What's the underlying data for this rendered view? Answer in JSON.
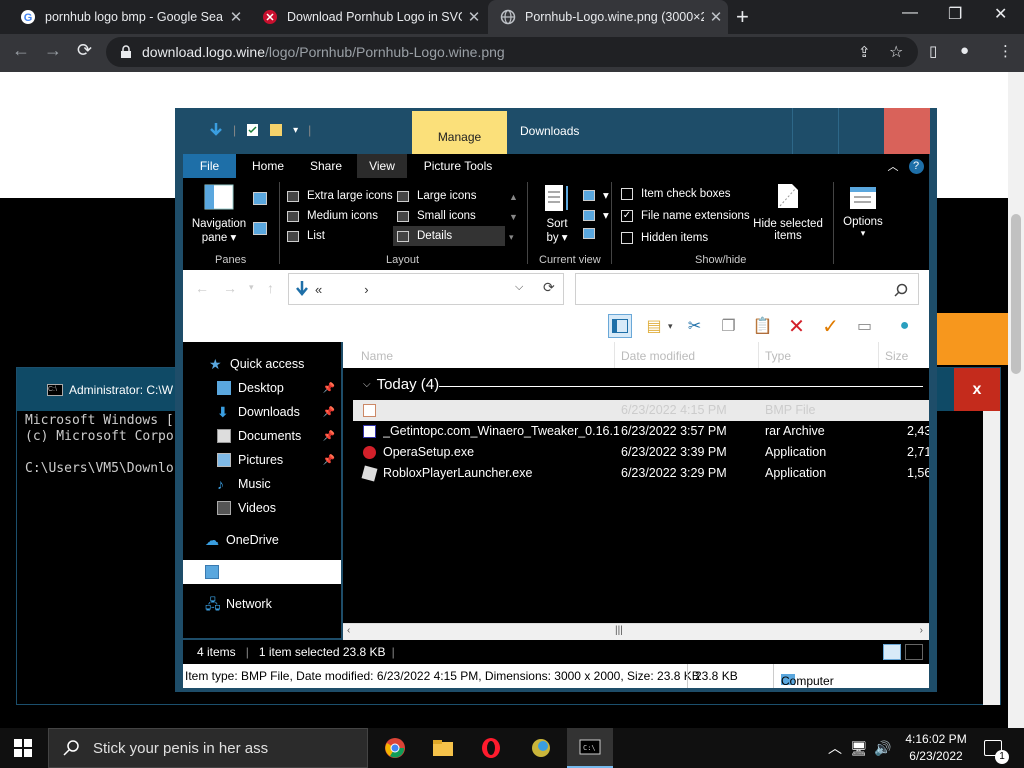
{
  "chrome": {
    "tabs": [
      {
        "title": "pornhub logo bmp - Google Sea",
        "icon": "google-icon"
      },
      {
        "title": "Download Pornhub Logo in SVG",
        "icon": "logowine-icon"
      },
      {
        "title": "Pornhub-Logo.wine.png (3000×2",
        "icon": "globe-icon"
      }
    ],
    "url_host": "download.logo.wine",
    "url_path": "/logo/Pornhub/Pornhub-Logo.wine.png"
  },
  "cmd": {
    "title": "Administrator: C:\\W",
    "lines": [
      "Microsoft Windows [",
      "(c) Microsoft Corpo",
      "",
      "C:\\Users\\VM5\\Downlo"
    ],
    "close": "x"
  },
  "explorer": {
    "manage_tab": "Manage",
    "window_title": "Downloads",
    "ribbon_tabs": [
      "File",
      "Home",
      "Share",
      "View",
      "Picture Tools"
    ],
    "panes": {
      "navigation_pane_l1": "Navigation",
      "navigation_pane_l2": "pane ▾",
      "label": "Panes"
    },
    "layout": {
      "label": "Layout",
      "items": [
        "Extra large icons",
        "Large icons",
        "Medium icons",
        "Small icons",
        "List",
        "Details"
      ]
    },
    "current_view": {
      "label": "Current view",
      "sort_l1": "Sort",
      "sort_l2": "by ▾"
    },
    "show_hide": {
      "label": "Show/hide",
      "item_check_boxes": "Item check boxes",
      "file_name_extensions": "File name extensions",
      "hidden_items": "Hidden items",
      "hide_selected_l1": "Hide selected",
      "hide_selected_l2": "items",
      "options": "Options"
    },
    "address": {
      "prefix": "«",
      "chevron": "›"
    },
    "nav": [
      {
        "label": "Quick access",
        "icon": "star-icon"
      },
      {
        "label": "Desktop",
        "icon": "desktop-icon",
        "pin": true
      },
      {
        "label": "Downloads",
        "icon": "download-icon",
        "pin": true
      },
      {
        "label": "Documents",
        "icon": "documents-icon",
        "pin": true
      },
      {
        "label": "Pictures",
        "icon": "pictures-icon",
        "pin": true
      },
      {
        "label": "Music",
        "icon": "music-icon"
      },
      {
        "label": "Videos",
        "icon": "videos-icon"
      },
      {
        "label": "OneDrive",
        "icon": "cloud-icon"
      },
      {
        "label": "",
        "icon": "computer-icon"
      },
      {
        "label": "Network",
        "icon": "network-icon"
      }
    ],
    "columns": [
      "Name",
      "Date modified",
      "Type",
      "Size"
    ],
    "group": "Today (4)",
    "files": [
      {
        "name": "",
        "date": "6/23/2022 4:15 PM",
        "type": "BMP File",
        "size": ""
      },
      {
        "name": "_Getintopc.com_Winaero_Tweaker_0.16.1...",
        "date": "6/23/2022 3:57 PM",
        "type": "rar Archive",
        "size": "2,43"
      },
      {
        "name": "OperaSetup.exe",
        "date": "6/23/2022 3:39 PM",
        "type": "Application",
        "size": "2,71"
      },
      {
        "name": "RobloxPlayerLauncher.exe",
        "date": "6/23/2022 3:29 PM",
        "type": "Application",
        "size": "1,56"
      }
    ],
    "status": {
      "items": "4 items",
      "selected": "1 item selected  23.8 KB",
      "sep": "|"
    },
    "details": {
      "info": "Item type: BMP File, Date modified: 6/23/2022 4:15 PM, Dimensions: 3000 x 2000, Size: 23.8 KB",
      "size": "23.8 KB",
      "location": "Computer"
    }
  },
  "taskbar": {
    "search_placeholder": "Stick your penis in her ass",
    "time": "4:16:02 PM",
    "date": "6/23/2022",
    "notification_count": "1"
  },
  "colors": {
    "explorer_frame": "#1e4d69",
    "manage_tab": "#fbe07a",
    "close_red": "#c42b1c",
    "orange": "#f7971d"
  }
}
